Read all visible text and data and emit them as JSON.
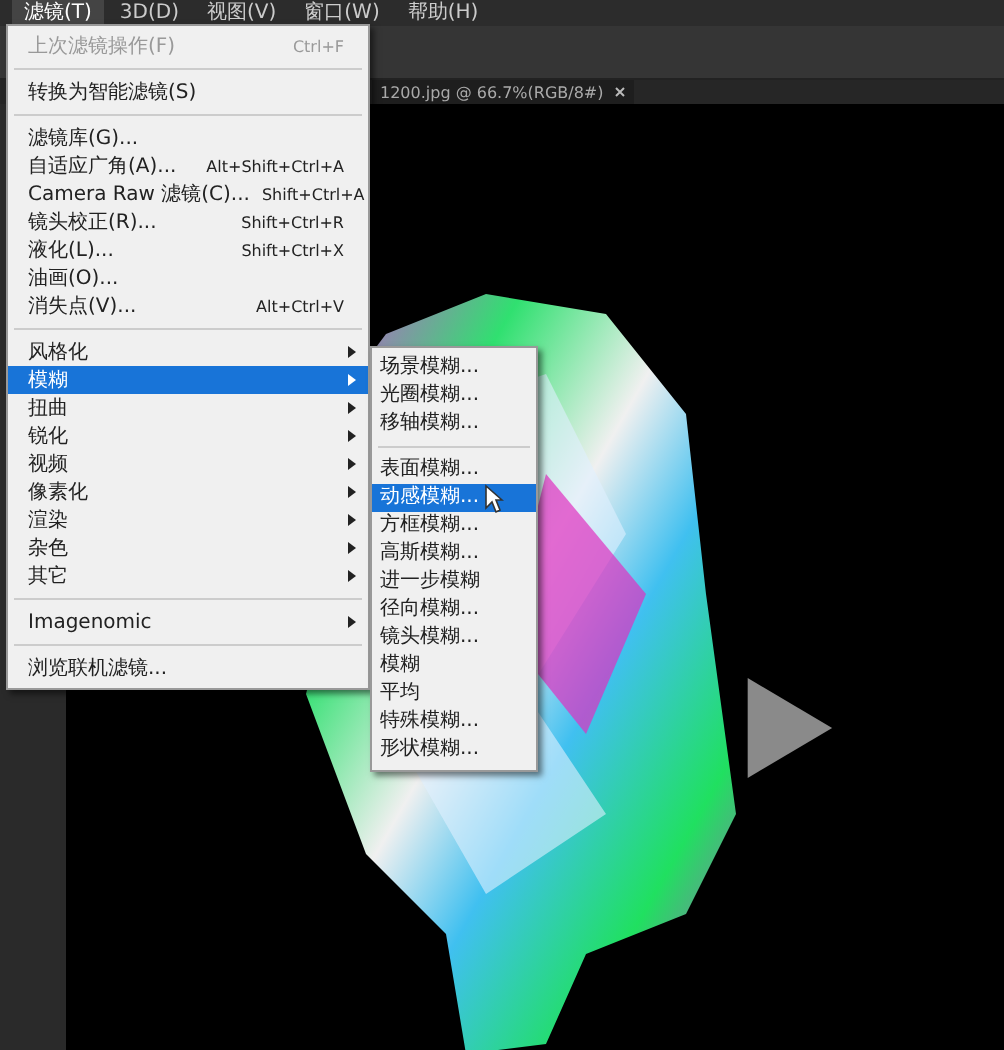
{
  "menu_bar": [
    {
      "label": "滤镜(T)",
      "selected": true
    },
    {
      "label": "3D(D)",
      "selected": false
    },
    {
      "label": "视图(V)",
      "selected": false
    },
    {
      "label": "窗口(W)",
      "selected": false
    },
    {
      "label": "帮助(H)",
      "selected": false
    }
  ],
  "document_tab": {
    "title": "1200.jpg @ 66.7%(RGB/8#)"
  },
  "filter_menu": {
    "sections": [
      [
        {
          "label": "上次滤镜操作(F)",
          "shortcut": "Ctrl+F",
          "disabled": true,
          "selected": false,
          "submenu": false
        }
      ],
      [
        {
          "label": "转换为智能滤镜(S)",
          "disabled": false,
          "selected": false,
          "submenu": false
        }
      ],
      [
        {
          "label": "滤镜库(G)...",
          "disabled": false,
          "selected": false,
          "submenu": false
        },
        {
          "label": "自适应广角(A)...",
          "shortcut": "Alt+Shift+Ctrl+A",
          "disabled": false,
          "selected": false,
          "submenu": false
        },
        {
          "label": "Camera Raw 滤镜(C)...",
          "shortcut": "Shift+Ctrl+A",
          "disabled": false,
          "selected": false,
          "submenu": false
        },
        {
          "label": "镜头校正(R)...",
          "shortcut": "Shift+Ctrl+R",
          "disabled": false,
          "selected": false,
          "submenu": false
        },
        {
          "label": "液化(L)...",
          "shortcut": "Shift+Ctrl+X",
          "disabled": false,
          "selected": false,
          "submenu": false
        },
        {
          "label": "油画(O)...",
          "disabled": false,
          "selected": false,
          "submenu": false
        },
        {
          "label": "消失点(V)...",
          "shortcut": "Alt+Ctrl+V",
          "disabled": false,
          "selected": false,
          "submenu": false
        }
      ],
      [
        {
          "label": "风格化",
          "disabled": false,
          "selected": false,
          "submenu": true
        },
        {
          "label": "模糊",
          "disabled": false,
          "selected": true,
          "submenu": true
        },
        {
          "label": "扭曲",
          "disabled": false,
          "selected": false,
          "submenu": true
        },
        {
          "label": "锐化",
          "disabled": false,
          "selected": false,
          "submenu": true
        },
        {
          "label": "视频",
          "disabled": false,
          "selected": false,
          "submenu": true
        },
        {
          "label": "像素化",
          "disabled": false,
          "selected": false,
          "submenu": true
        },
        {
          "label": "渲染",
          "disabled": false,
          "selected": false,
          "submenu": true
        },
        {
          "label": "杂色",
          "disabled": false,
          "selected": false,
          "submenu": true
        },
        {
          "label": "其它",
          "disabled": false,
          "selected": false,
          "submenu": true
        }
      ],
      [
        {
          "label": "Imagenomic",
          "disabled": false,
          "selected": false,
          "submenu": true
        }
      ],
      [
        {
          "label": "浏览联机滤镜...",
          "disabled": false,
          "selected": false,
          "submenu": false
        }
      ]
    ]
  },
  "blur_submenu": {
    "sections": [
      [
        {
          "label": "场景模糊...",
          "selected": false
        },
        {
          "label": "光圈模糊...",
          "selected": false
        },
        {
          "label": "移轴模糊...",
          "selected": false
        }
      ],
      [
        {
          "label": "表面模糊...",
          "selected": false
        },
        {
          "label": "动感模糊...",
          "selected": true
        },
        {
          "label": "方框模糊...",
          "selected": false
        },
        {
          "label": "高斯模糊...",
          "selected": false
        },
        {
          "label": "进一步模糊",
          "selected": false
        },
        {
          "label": "径向模糊...",
          "selected": false
        },
        {
          "label": "镜头模糊...",
          "selected": false
        },
        {
          "label": "模糊",
          "selected": false
        },
        {
          "label": "平均",
          "selected": false
        },
        {
          "label": "特殊模糊...",
          "selected": false
        },
        {
          "label": "形状模糊...",
          "selected": false
        }
      ]
    ]
  }
}
